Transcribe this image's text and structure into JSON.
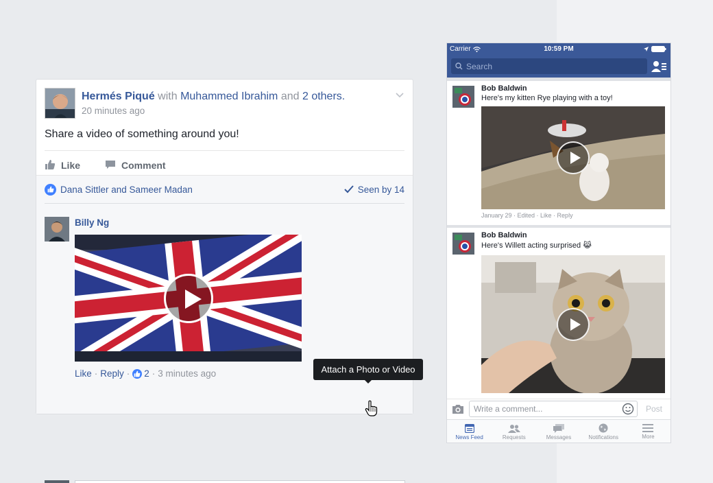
{
  "colors": {
    "background": "#e9ebee",
    "brand": "#3b5998",
    "link": "#365899",
    "like_blue": "#4080ff"
  },
  "post": {
    "author": "Hermés Piqué",
    "with_word": "with",
    "tagged": "Muhammed Ibrahim",
    "and_word": "and",
    "others": "2 others.",
    "time": "20 minutes ago",
    "text": "Share a video of something around you!",
    "actions": {
      "like_label": "Like",
      "comment_label": "Comment"
    },
    "likers": "Dana Sittler and Sameer Madan",
    "seen_by": "Seen by 14"
  },
  "comment": {
    "author": "Billy Ng",
    "like_label": "Like",
    "separator": "·",
    "reply_label": "Reply",
    "like_count": "2",
    "time": "3 minutes ago"
  },
  "composer": {
    "placeholder": "Write a comment...",
    "tooltip": "Attach a Photo or Video"
  },
  "phone": {
    "status": {
      "carrier": "Carrier",
      "time": "10:59 PM"
    },
    "search_placeholder": "Search",
    "stories": [
      {
        "author": "Bob Baldwin",
        "text": "Here's my kitten Rye playing with a toy!",
        "meta": "January 29 · Edited · Like · Reply"
      },
      {
        "author": "Bob Baldwin",
        "text": "Here's Willett acting surprised 😹"
      }
    ],
    "composer_placeholder": "Write a comment...",
    "post_label": "Post",
    "tabs": [
      "News Feed",
      "Requests",
      "Messages",
      "Notifications",
      "More"
    ]
  }
}
